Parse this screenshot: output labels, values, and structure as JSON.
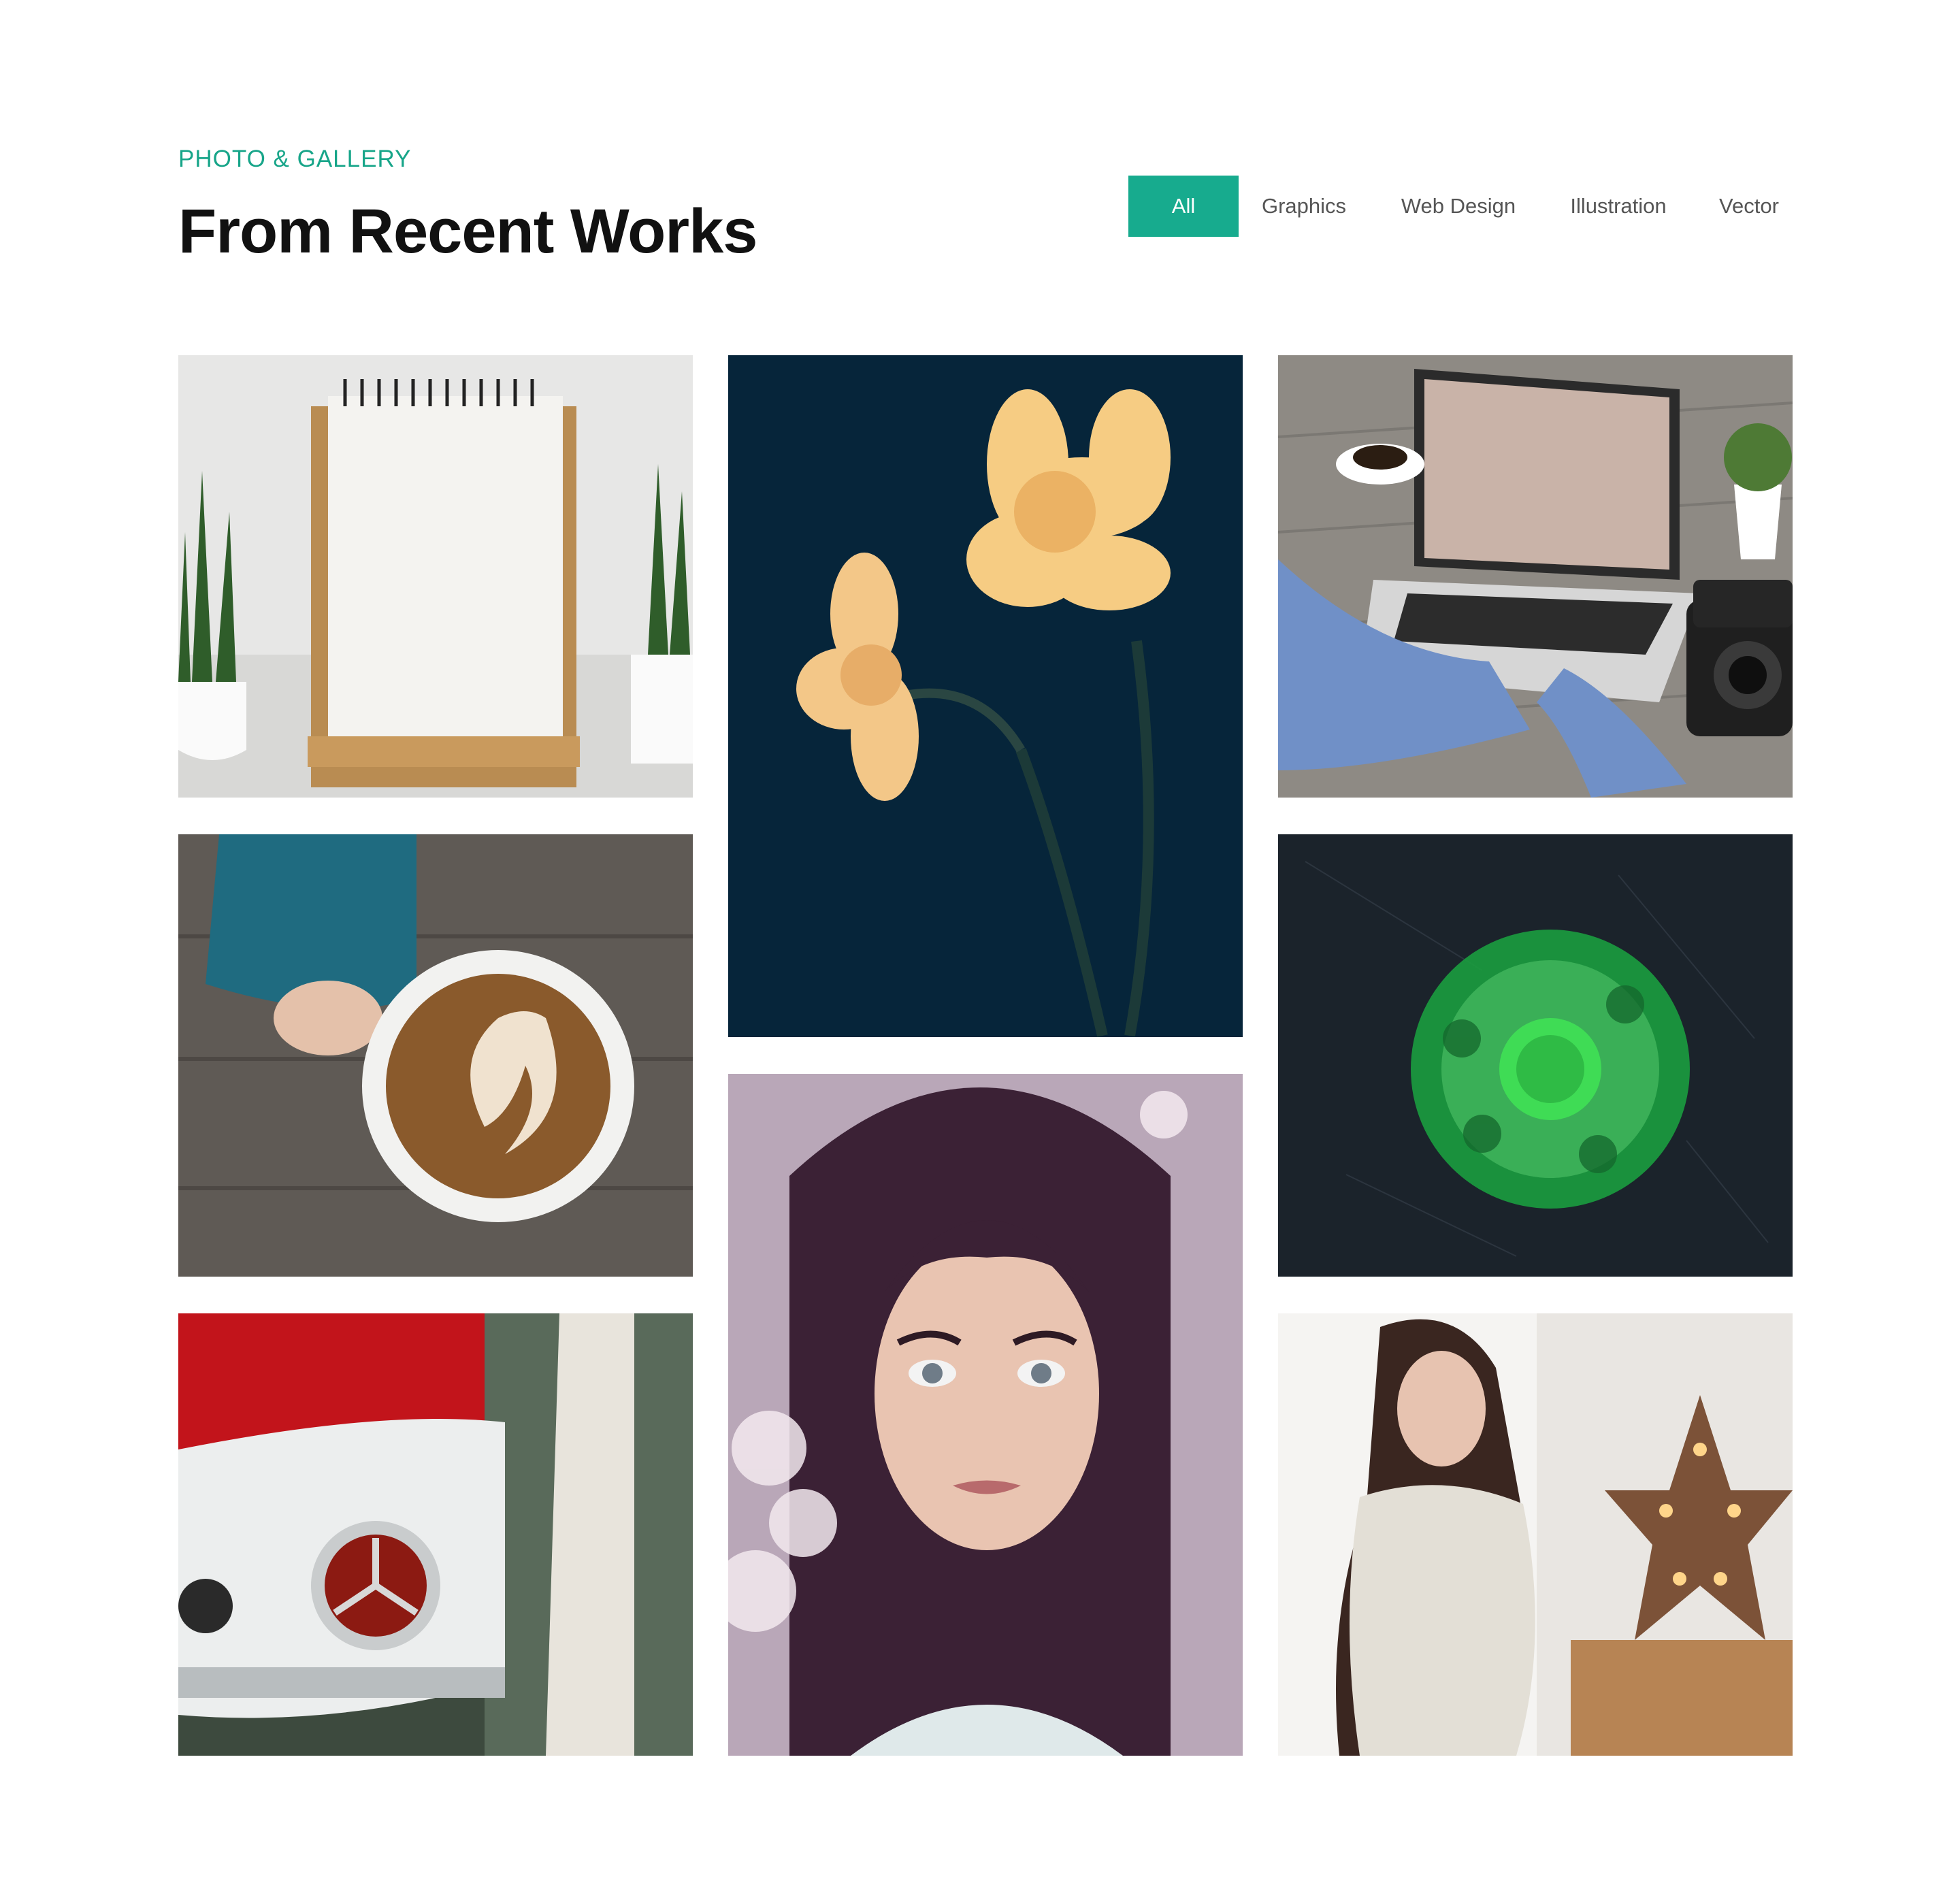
{
  "header": {
    "eyebrow": "PHOTO & GALLERY",
    "title": "From Recent Works"
  },
  "filters": [
    {
      "label": "All",
      "active": true
    },
    {
      "label": "Graphics",
      "active": false
    },
    {
      "label": "Web Design",
      "active": false
    },
    {
      "label": "Illustration",
      "active": false
    },
    {
      "label": "Vector",
      "active": false
    }
  ],
  "colors": {
    "accent": "#17ab8e",
    "eyebrow": "#17a589",
    "title": "#111111"
  },
  "gallery": [
    {
      "subject": "notebook-on-stand"
    },
    {
      "subject": "daffodils"
    },
    {
      "subject": "laptop-workspace"
    },
    {
      "subject": "latte-coffee"
    },
    {
      "subject": "fidget-spinner"
    },
    {
      "subject": "woman-portrait"
    },
    {
      "subject": "vintage-car"
    },
    {
      "subject": "woman-with-star-lamp"
    }
  ]
}
